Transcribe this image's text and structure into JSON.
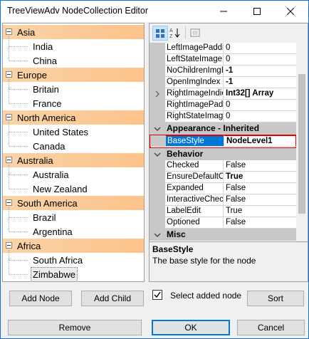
{
  "window": {
    "title": "TreeViewAdv NodeCollection Editor",
    "controls": {
      "minimize": "minimize-icon",
      "maximize": "maximize-icon",
      "close": "close-icon"
    }
  },
  "tree": {
    "groups": [
      {
        "label": "Asia",
        "children": [
          "India",
          "China"
        ]
      },
      {
        "label": "Europe",
        "children": [
          "Britain",
          "France"
        ]
      },
      {
        "label": "North America",
        "children": [
          "United States",
          "Canada"
        ]
      },
      {
        "label": "Australia",
        "children": [
          "Australia",
          "New Zealand"
        ]
      },
      {
        "label": "South America",
        "children": [
          "Brazil",
          "Argentina"
        ]
      },
      {
        "label": "Africa",
        "children": [
          "South Africa",
          "Zimbabwe"
        ]
      }
    ],
    "selected": "Zimbabwe"
  },
  "property_grid": {
    "toolbar": {
      "categorized": "categorized-icon",
      "alphabetical": "sort-alphabetical-icon",
      "pages": "property-pages-icon"
    },
    "rows": [
      {
        "kind": "prop",
        "name": "LeftImagePaddi",
        "value": "0",
        "bold": false
      },
      {
        "kind": "prop",
        "name": "LeftStateImageF",
        "value": "0",
        "bold": false
      },
      {
        "kind": "prop",
        "name": "NoChildrenImgIr",
        "value": "-1",
        "bold": true
      },
      {
        "kind": "prop",
        "name": "OpenImgIndex",
        "value": "-1",
        "bold": true
      },
      {
        "kind": "prop",
        "name": "RightImageIndic",
        "value": "Int32[] Array",
        "bold": true,
        "expandable": true
      },
      {
        "kind": "prop",
        "name": "RightImagePadc",
        "value": "0",
        "bold": false
      },
      {
        "kind": "prop",
        "name": "RightStateImag",
        "value": "0",
        "bold": false
      },
      {
        "kind": "category",
        "name": "Appearance - Inherited"
      },
      {
        "kind": "prop",
        "name": "BaseStyle",
        "value": "NodeLevel1",
        "bold": true,
        "selected": true
      },
      {
        "kind": "category",
        "name": "Behavior"
      },
      {
        "kind": "prop",
        "name": "Checked",
        "value": "False",
        "bold": false
      },
      {
        "kind": "prop",
        "name": "EnsureDefaultO",
        "value": "True",
        "bold": true
      },
      {
        "kind": "prop",
        "name": "Expanded",
        "value": "False",
        "bold": false
      },
      {
        "kind": "prop",
        "name": "InteractiveChec",
        "value": "False",
        "bold": false
      },
      {
        "kind": "prop",
        "name": "LabelEdit",
        "value": "True",
        "bold": false
      },
      {
        "kind": "prop",
        "name": "Optioned",
        "value": "False",
        "bold": false
      },
      {
        "kind": "category",
        "name": "Misc"
      }
    ],
    "description": {
      "title": "BaseStyle",
      "text": "The base style for the node"
    }
  },
  "buttons": {
    "add_node": "Add Node",
    "add_child": "Add Child",
    "select_added": "Select added node",
    "select_added_checked": true,
    "sort": "Sort",
    "remove": "Remove",
    "ok": "OK",
    "cancel": "Cancel"
  },
  "colors": {
    "accent": "#0078d7",
    "group_header": "#fcc38a",
    "highlight": "#e00000",
    "selected_row": "#0078d7"
  }
}
